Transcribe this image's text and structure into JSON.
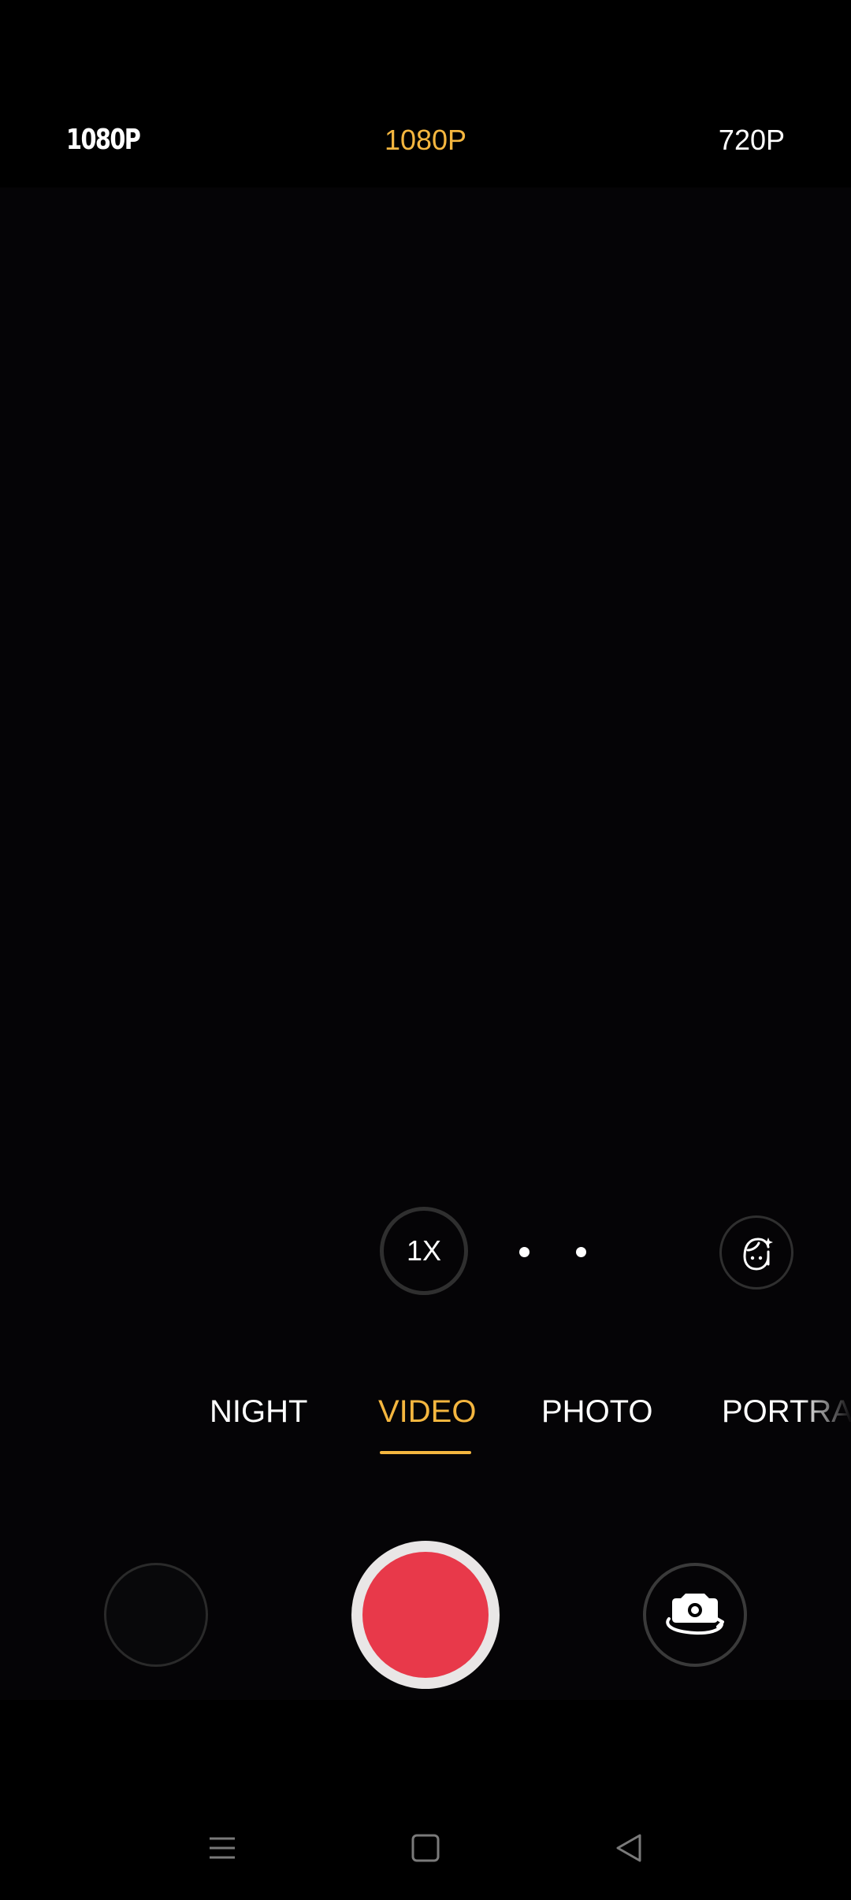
{
  "resolution_bar": {
    "left_label": "1080P",
    "center_label": "1080P",
    "right_label": "720P",
    "selected_color": "#f4b63f"
  },
  "zoom": {
    "current_label": "1X",
    "level_dots": 2
  },
  "beauty": {
    "icon": "face-beauty-icon"
  },
  "modes": {
    "items": [
      {
        "label": "NIGHT",
        "selected": false
      },
      {
        "label": "VIDEO",
        "selected": true
      },
      {
        "label": "PHOTO",
        "selected": false
      },
      {
        "label": "PORTRA",
        "selected": false
      }
    ],
    "accent_color": "#f4b63f"
  },
  "capture_row": {
    "gallery_icon": "gallery-thumbnail",
    "shutter_color": "#e8394a",
    "flip_icon": "camera-flip-icon"
  },
  "nav_bar": {
    "menu_icon": "menu-icon",
    "home_icon": "home-icon",
    "back_icon": "back-icon"
  }
}
